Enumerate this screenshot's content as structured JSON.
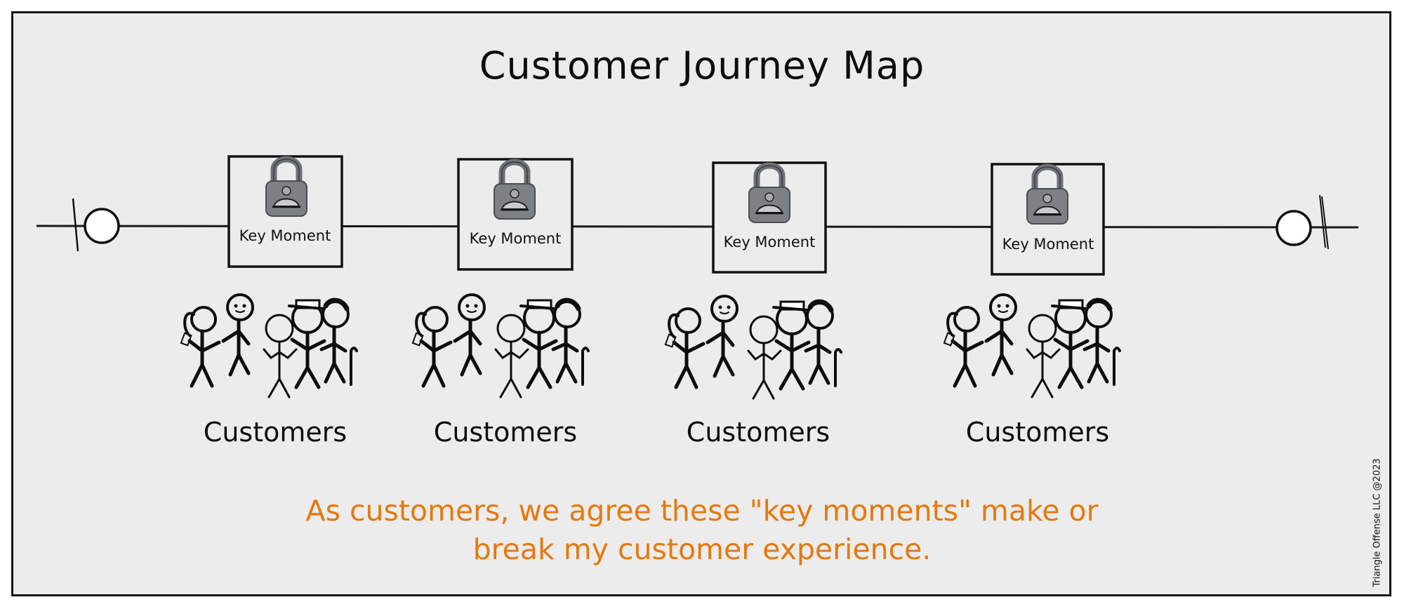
{
  "title": "Customer Journey Map",
  "colors": {
    "background": "#ececec",
    "ink": "#111111",
    "accent": "#e5790f",
    "lock": "#7d8085"
  },
  "timeline": {
    "start_marker": "start-circle",
    "end_marker": "end-circle"
  },
  "key_moments": [
    {
      "label": "Key Moment",
      "icon": "lock-icon"
    },
    {
      "label": "Key Moment",
      "icon": "lock-icon"
    },
    {
      "label": "Key Moment",
      "icon": "lock-icon"
    },
    {
      "label": "Key Moment",
      "icon": "lock-icon"
    }
  ],
  "customer_groups": [
    {
      "label": "Customers",
      "icon": "stick-figures-group"
    },
    {
      "label": "Customers",
      "icon": "stick-figures-group"
    },
    {
      "label": "Customers",
      "icon": "stick-figures-group"
    },
    {
      "label": "Customers",
      "icon": "stick-figures-group"
    }
  ],
  "footer": {
    "line1": "As customers, we agree these \"key moments\" make or",
    "line2": "break my customer experience."
  },
  "copyright": "Triangle Offense LLC @2023"
}
